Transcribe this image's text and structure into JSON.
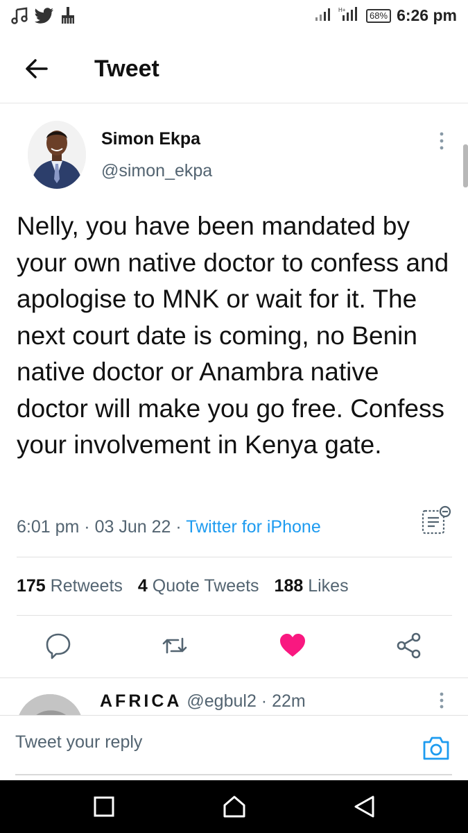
{
  "status_bar": {
    "time": "6:26 pm",
    "battery": "68%",
    "left_icons": [
      "music-note-icon",
      "twitter-bird-icon",
      "broom-icon"
    ],
    "right_icons": [
      "signal-bars-icon",
      "signal-bars-icon",
      "battery-icon"
    ]
  },
  "header": {
    "title": "Tweet",
    "back_icon": "arrow-left-icon"
  },
  "tweet": {
    "author_name": "Simon Ekpa",
    "author_handle": "@simon_ekpa",
    "text": "Nelly, you have been mandated by your own native doctor to confess and apologise to MNK or wait for it. The next court date is coming, no Benin native doctor or Anambra native doctor will make you go free. Confess your involvement in Kenya gate.",
    "time": "6:01 pm",
    "date": "03 Jun 22",
    "separator": "·",
    "source": "Twitter for iPhone",
    "stats": {
      "retweets_count": "175",
      "retweets_label": "Retweets",
      "quotes_count": "4",
      "quotes_label": "Quote Tweets",
      "likes_count": "188",
      "likes_label": "Likes"
    },
    "actions": [
      "reply-icon",
      "retweet-icon",
      "like-heart-icon",
      "share-icon"
    ],
    "liked_color": "#f91880"
  },
  "reply_preview": {
    "name": "AFRICA",
    "handle": "@egbul2",
    "time": "22m"
  },
  "compose": {
    "placeholder": "Tweet your reply"
  },
  "colors": {
    "accent": "#1d9bf0",
    "muted_text": "#536471"
  }
}
